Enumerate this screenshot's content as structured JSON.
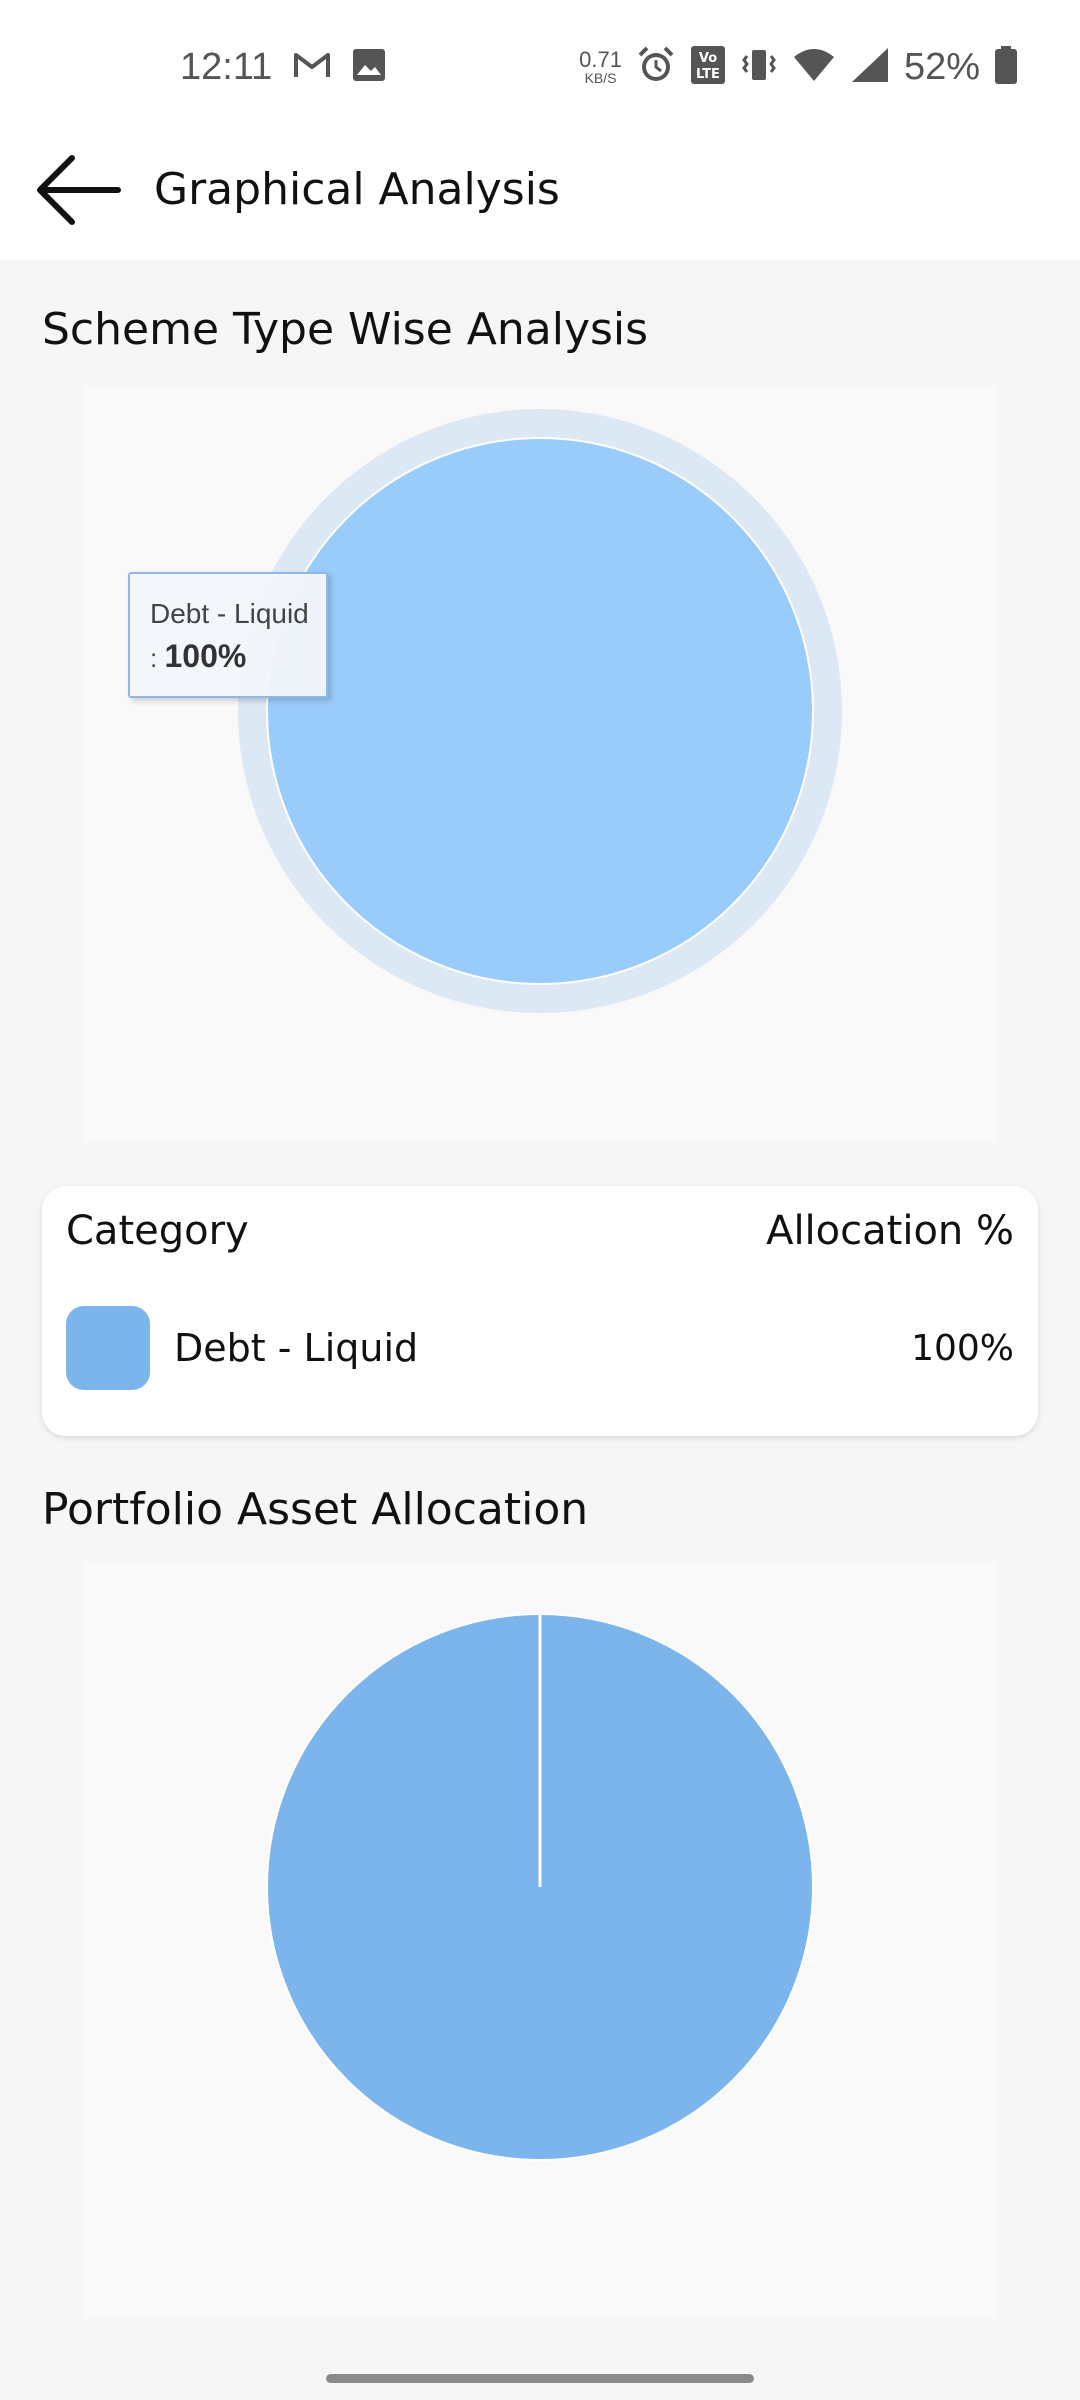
{
  "status_bar": {
    "time": "12:11",
    "net_speed_value": "0.71",
    "net_speed_unit": "KB/S",
    "battery_percent": "52%",
    "icons": [
      "gmail-icon",
      "gallery-icon",
      "alarm-icon",
      "volte-icon",
      "vibrate-icon",
      "wifi-icon",
      "signal-icon",
      "battery-icon"
    ]
  },
  "app_bar": {
    "title": "Graphical Analysis",
    "back_icon": "arrow-left-icon"
  },
  "scheme_section": {
    "title": "Scheme Type Wise Analysis",
    "tooltip": {
      "label": "Debt - Liquid",
      "prefix": ":",
      "value": "100%"
    }
  },
  "legend": {
    "category_header": "Category",
    "allocation_header": "Allocation %",
    "rows": [
      {
        "name": "Debt - Liquid",
        "value": "100%",
        "color": "#7cb4ec"
      }
    ]
  },
  "asset_section": {
    "title": "Portfolio Asset Allocation"
  },
  "colors": {
    "slice": "#7cb4ec",
    "slice_hover": "#99cbfb",
    "halo": "#dce8f4",
    "panel": "#f9f9f9",
    "page_bg": "#f6f6f6"
  },
  "chart_data": [
    {
      "type": "pie",
      "title": "",
      "categories": [
        "Debt - Liquid"
      ],
      "values": [
        100
      ],
      "hover_state": true
    },
    {
      "type": "pie",
      "title": "",
      "categories": [
        ""
      ],
      "values": [
        100
      ],
      "hover_state": false
    }
  ]
}
